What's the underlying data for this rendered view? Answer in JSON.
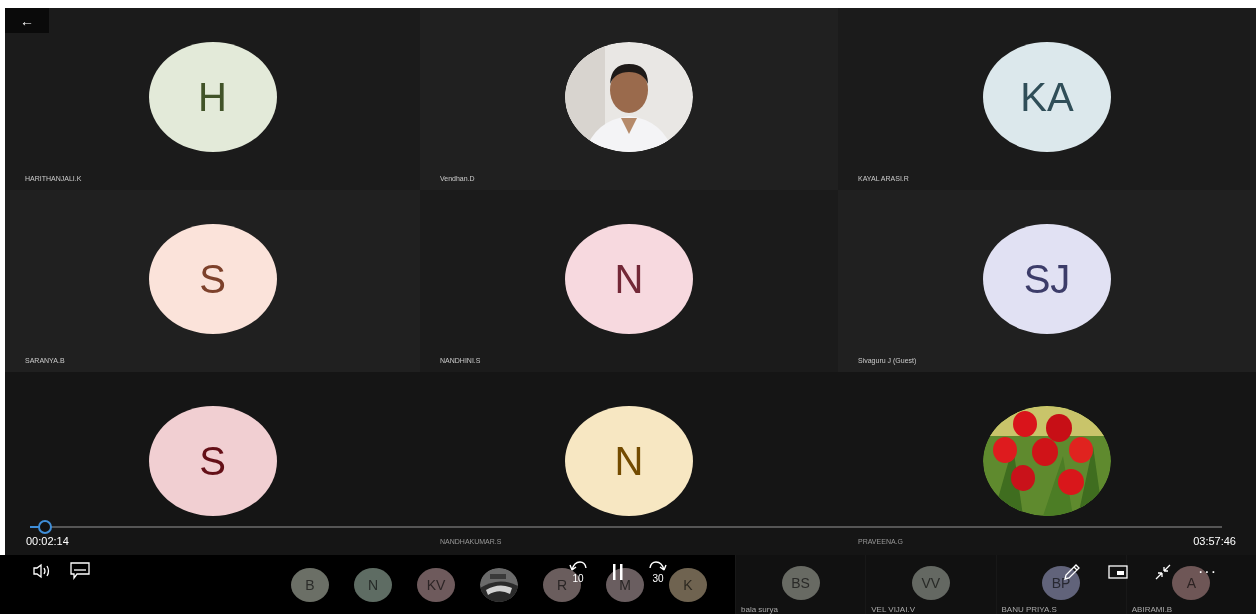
{
  "back_button": {
    "label": "←"
  },
  "tiles": [
    {
      "name": "HARITHANJALI.K",
      "kind": "initials",
      "initials": "H",
      "color": "#e3ead9"
    },
    {
      "name": "Vendhan.D",
      "kind": "picture"
    },
    {
      "name": "KAYAL ARASI.R",
      "kind": "initials",
      "initials": "KA",
      "color": "#dce8ec"
    },
    {
      "name": "SARANYA.B",
      "kind": "initials",
      "initials": "S",
      "color": "#fbe3da"
    },
    {
      "name": "NANDHINI.S",
      "kind": "initials",
      "initials": "N",
      "color": "#f7d9df"
    },
    {
      "name": "Sivaguru J (Guest)",
      "kind": "initials",
      "initials": "SJ",
      "color": "#e1e1f3"
    },
    {
      "kind": "initials",
      "initials": "S",
      "color": "#f1cfd2"
    },
    {
      "name": "NANDHAKUMAR.S",
      "kind": "initials",
      "initials": "N",
      "color": "#f7e7c2"
    },
    {
      "name": "PRAVEENA.G",
      "kind": "picture"
    }
  ],
  "progress": {
    "level": 0.013,
    "elapsed": "00:02:14",
    "total": "03:57:46"
  },
  "strip_small": [
    {
      "kind": "initials",
      "initials": "B",
      "color": "#6b6f66"
    },
    {
      "kind": "initials",
      "initials": "N",
      "color": "#5e6c63"
    },
    {
      "kind": "initials",
      "initials": "KV",
      "color": "#6e5a5c"
    },
    {
      "kind": "picture"
    },
    {
      "kind": "initials",
      "initials": "R",
      "color": "#6a5d5d"
    },
    {
      "kind": "initials",
      "initials": "M",
      "color": "#6a5e60"
    },
    {
      "kind": "initials",
      "initials": "K",
      "color": "#6f6350"
    }
  ],
  "strip_tiles": [
    {
      "initials": "BS",
      "name": "bala surya",
      "color": "#686a63"
    },
    {
      "initials": "VV",
      "name": "VEL VIJAI.V",
      "color": "#646862"
    },
    {
      "initials": "BP",
      "name": "BANU PRIYA.S",
      "color": "#61637a"
    },
    {
      "initials": "A",
      "name": "ABIRAMI.B",
      "color": "#6e5656"
    }
  ],
  "controls": {
    "rewind_label": "10",
    "forward_label": "30",
    "more_label": "···"
  }
}
